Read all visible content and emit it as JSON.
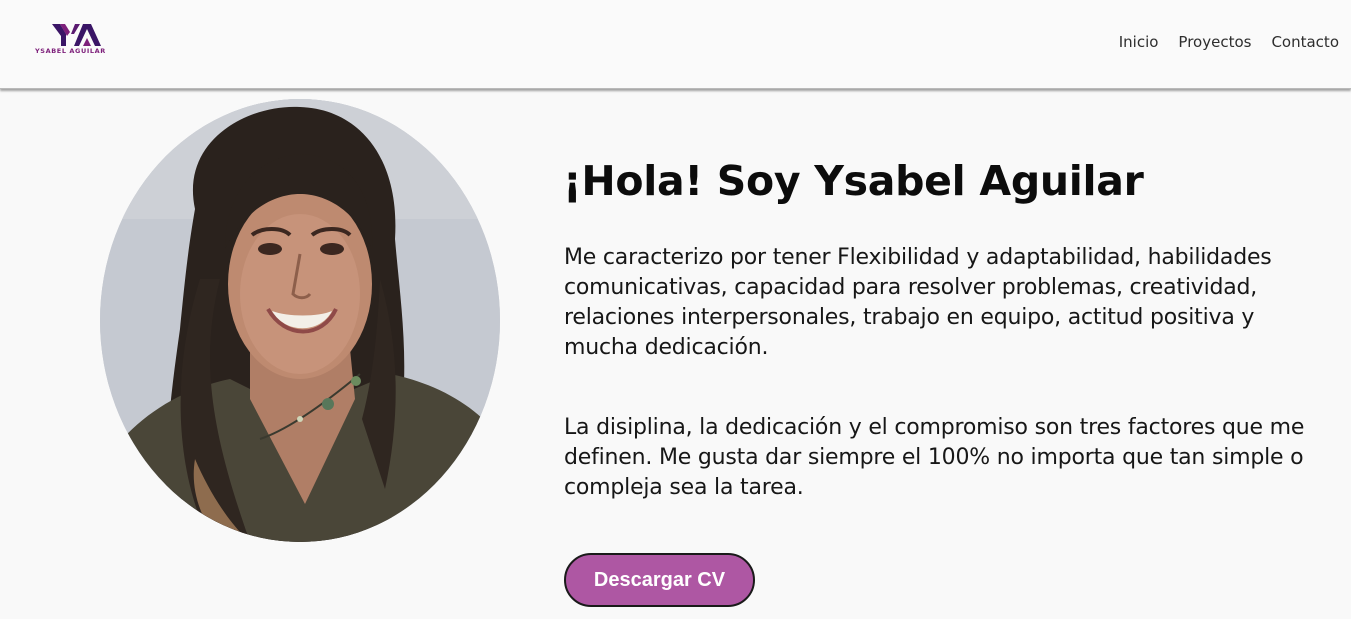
{
  "header": {
    "logo_letters": "YA",
    "logo_wordmark": "YSABEL AGUILAR",
    "brand_color": "#7d1f7a",
    "nav": [
      {
        "label": "Inicio"
      },
      {
        "label": "Proyectos"
      },
      {
        "label": "Contacto"
      }
    ]
  },
  "hero": {
    "title": "¡Hola! Soy Ysabel Aguilar",
    "paragraphs": [
      "Me caracterizo por tener Flexibilidad y adaptabilidad, habilidades comunicativas, capacidad para resolver problemas, creatividad, relaciones interpersonales, trabajo en equipo, actitud positiva y mucha dedicación.",
      "La disiplina, la dedicación y el compromiso son tres factores que me definen. Me gusta dar siempre el 100% no importa que tan simple o compleja sea la tarea."
    ],
    "cta_label": "Descargar CV",
    "cta_color": "#ae57a3"
  }
}
